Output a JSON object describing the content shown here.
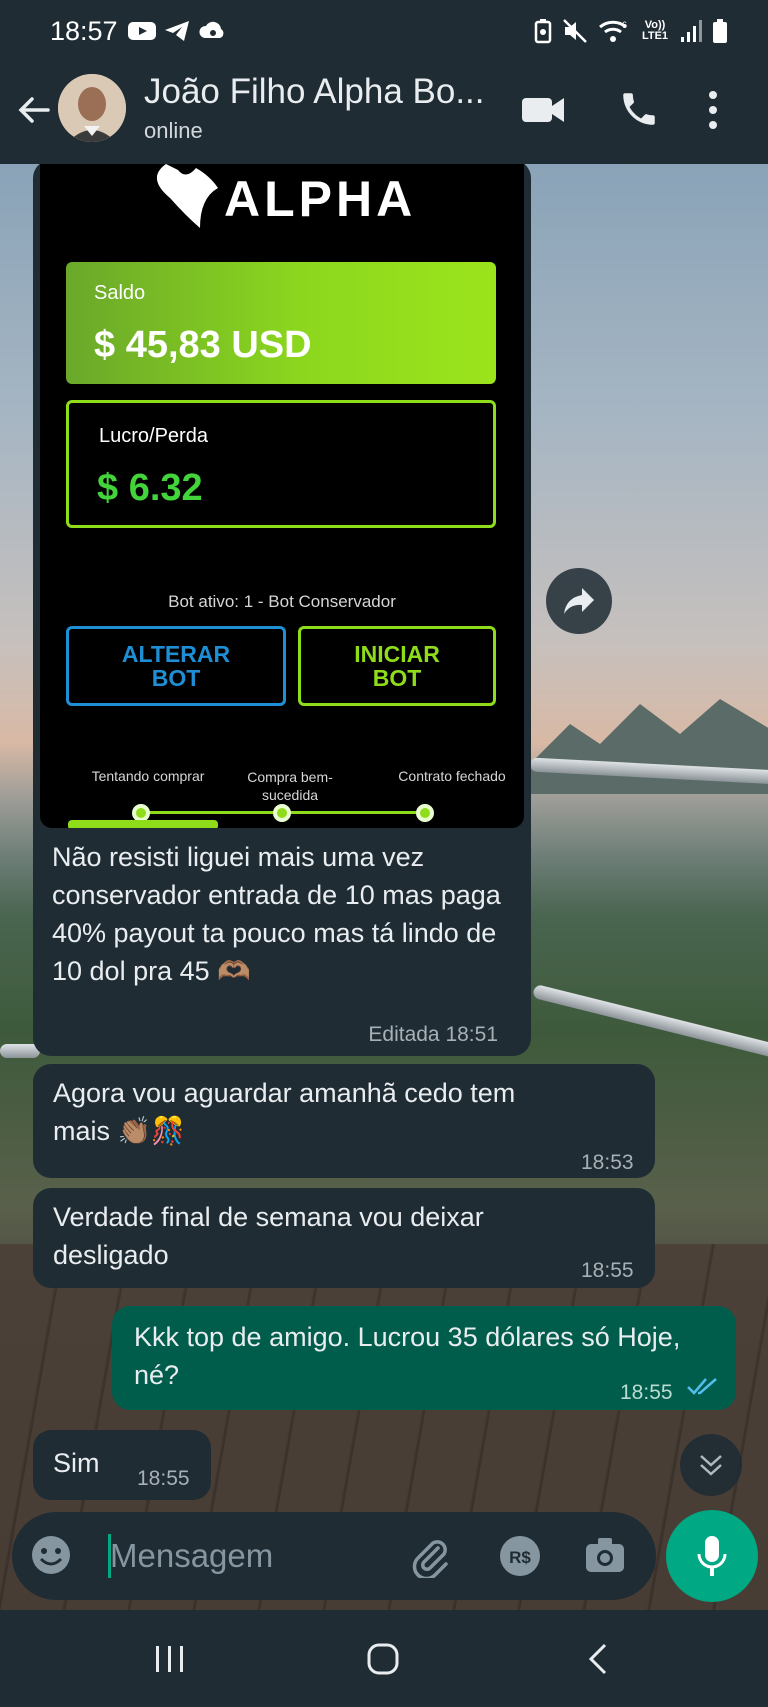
{
  "status_bar": {
    "time": "18:57",
    "network_label": "Vo)) LTE1",
    "network_gen": "6"
  },
  "header": {
    "contact_name": "João Filho Alpha Bo...",
    "contact_status": "online"
  },
  "image_message": {
    "saldo_label": "Saldo",
    "saldo_value": "$ 45,83 USD",
    "lucro_label": "Lucro/Perda",
    "lucro_value": "$ 6.32",
    "bot_status": "Bot ativo: 1 - Bot Conservador",
    "alterar_line1": "ALTERAR",
    "alterar_line2": "BOT",
    "iniciar_line1": "INICIAR",
    "iniciar_line2": "BOT",
    "step1": "Tentando comprar",
    "step2_line1": "Compra bem-",
    "step2_line2": "sucedida",
    "step3": "Contrato fechado",
    "logo_text": "ALPHA",
    "caption": "Não resisti liguei mais uma vez conservador entrada de 10 mas paga 40% payout ta pouco mas tá lindo de 10 dol pra 45 🫶🏽",
    "caption_meta": "Editada 18:51"
  },
  "messages": [
    {
      "direction": "in",
      "text": "Agora vou aguardar amanhã cedo tem mais 👏🏽🎊",
      "time": "18:53"
    },
    {
      "direction": "in",
      "text": "Verdade final de semana vou deixar desligado",
      "time": "18:55"
    },
    {
      "direction": "out",
      "text": "Kkk top de amigo. Lucrou 35 dólares só Hoje, né?",
      "time": "18:55",
      "read": true
    },
    {
      "direction": "in",
      "text": "Sim",
      "time": "18:55"
    }
  ],
  "composer": {
    "placeholder": "Mensagem"
  },
  "colors": {
    "header_bg": "#1f2c34",
    "incoming_bubble": "#1f2c34",
    "outgoing_bubble": "#005c4b",
    "accent": "#00a884",
    "read_ticks": "#53bdeb"
  }
}
